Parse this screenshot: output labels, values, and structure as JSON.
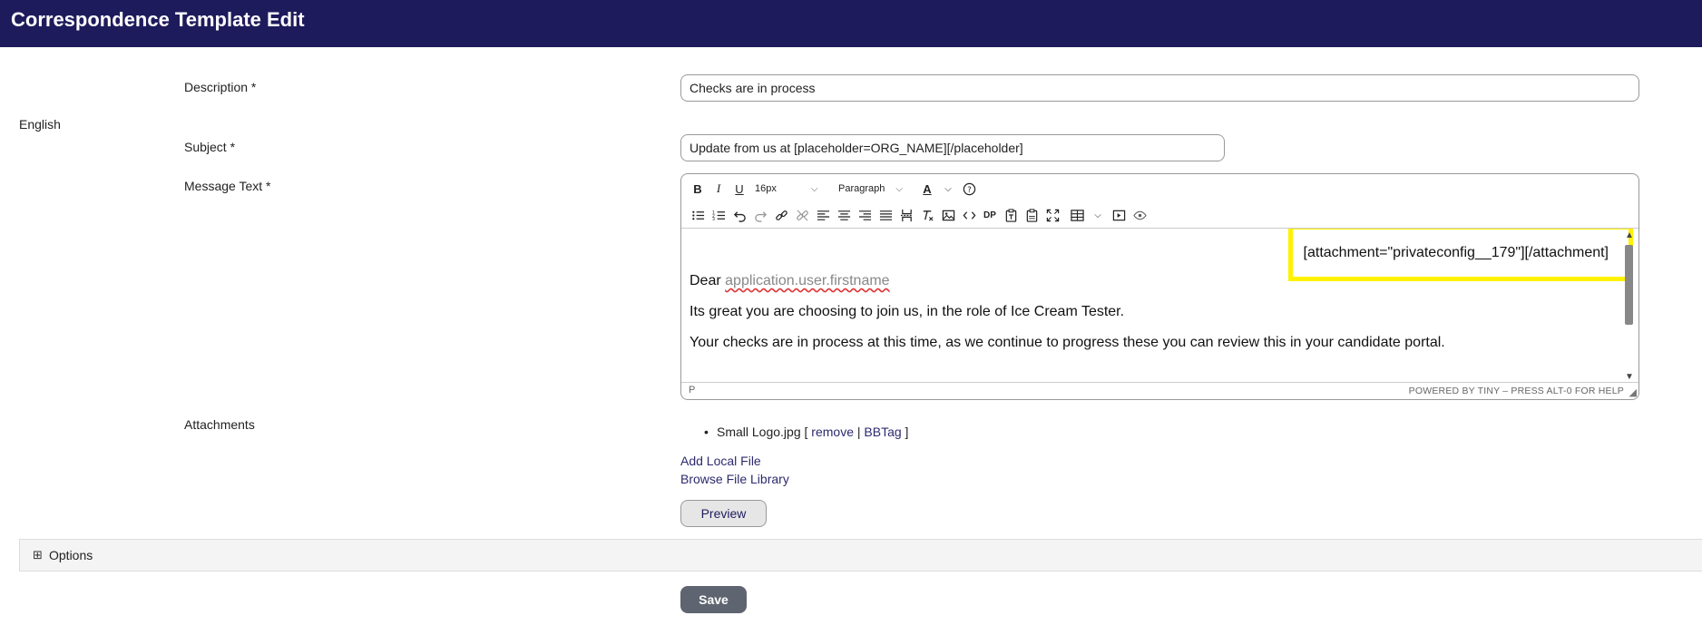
{
  "header": {
    "title": "Correspondence Template Edit"
  },
  "language": "English",
  "form": {
    "description": {
      "label": "Description *",
      "value": "Checks are in process"
    },
    "subject": {
      "label": "Subject *",
      "value": "Update from us at [placeholder=ORG_NAME][/placeholder]"
    },
    "message": {
      "label": "Message Text *",
      "toolbar": {
        "bold": "B",
        "italic": "I",
        "underline": "U",
        "font_size": "16px",
        "block_format": "Paragraph",
        "text_color": "A",
        "dp": "DP"
      },
      "content": {
        "attachment_tag": "[attachment=\"privateconfig__179\"][/attachment]",
        "greeting_prefix": "Dear",
        "greeting_placeholder": "application.user.firstname",
        "line2": "Its great you are choosing to join us, in the role of Ice Cream Tester.",
        "line3": "Your checks are in process at this time, as we continue to progress these you can review this in your candidate portal."
      },
      "status": {
        "path": "P",
        "branding": "POWERED BY TINY – PRESS ALT-0 FOR HELP"
      }
    },
    "attachments": {
      "label": "Attachments",
      "items": [
        {
          "filename": "Small Logo.jpg",
          "open": "[",
          "remove": "remove",
          "sep": "|",
          "bbtag": "BBTag",
          "close": "]"
        }
      ],
      "add_local": "Add Local File",
      "browse_library": "Browse File Library"
    },
    "preview_label": "Preview",
    "options_label": "Options",
    "save_label": "Save"
  }
}
